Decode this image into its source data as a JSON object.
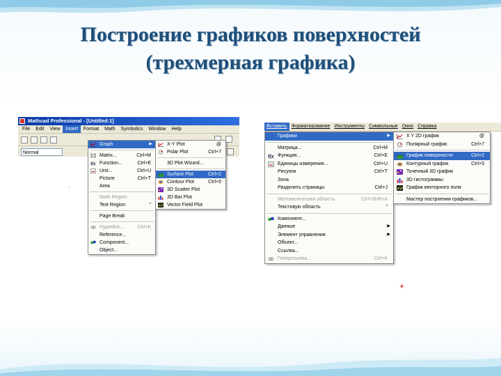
{
  "slide": {
    "title_line1": "Построение графиков поверхностей",
    "title_line2": "(трехмерная графика)"
  },
  "left": {
    "window_title": "Mathcad Professional - [Untitled:1]",
    "menubar": [
      "File",
      "Edit",
      "View",
      "Insert",
      "Format",
      "Math",
      "Symbolics",
      "Window",
      "Help"
    ],
    "style_value": "Normal",
    "insert_menu": [
      {
        "label": "Graph",
        "shortcut": "",
        "state": "sel",
        "submenu": true,
        "icon": "graph-icon"
      },
      {
        "sep": true
      },
      {
        "label": "Matrix...",
        "shortcut": "Ctrl+M",
        "icon": "matrix-icon"
      },
      {
        "label": "Function...",
        "shortcut": "Ctrl+E",
        "icon": "function-icon"
      },
      {
        "label": "Unit...",
        "shortcut": "Ctrl+U",
        "icon": "unit-icon"
      },
      {
        "label": "Picture",
        "shortcut": "Ctrl+T"
      },
      {
        "label": "Area"
      },
      {
        "sep": true
      },
      {
        "label": "Math Region",
        "state": "dis"
      },
      {
        "label": "Text Region",
        "shortcut": "\""
      },
      {
        "sep": true
      },
      {
        "label": "Page Break"
      },
      {
        "sep": true
      },
      {
        "label": "Hyperlink...",
        "shortcut": "Ctrl+K",
        "state": "dis",
        "icon": "hyperlink-icon"
      },
      {
        "label": "Reference..."
      },
      {
        "label": "Component...",
        "icon": "component-icon"
      },
      {
        "label": "Object..."
      }
    ],
    "graph_submenu": [
      {
        "label": "X-Y Plot",
        "shortcut": "@",
        "icon": "xy-plot-icon"
      },
      {
        "label": "Polar Plot",
        "shortcut": "Ctrl+7",
        "icon": "polar-plot-icon"
      },
      {
        "sep": true
      },
      {
        "label": "3D Plot Wizard..."
      },
      {
        "sep": true
      },
      {
        "label": "Surface Plot",
        "shortcut": "Ctrl+2",
        "state": "sel",
        "icon": "surface-plot-icon"
      },
      {
        "label": "Contour Plot",
        "shortcut": "Ctrl+5",
        "icon": "contour-plot-icon"
      },
      {
        "label": "3D Scatter Plot",
        "icon": "scatter-plot-icon"
      },
      {
        "label": "3D Bar Plot",
        "icon": "bar-plot-icon"
      },
      {
        "label": "Vector Field Plot",
        "icon": "vector-field-icon"
      }
    ]
  },
  "right": {
    "menubar": [
      "Вставить",
      "Форматирование",
      "Инструменты",
      "Символьные",
      "Окно",
      "Справка"
    ],
    "insert_menu": [
      {
        "label": "Графики",
        "state": "sel",
        "submenu": true
      },
      {
        "sep": true
      },
      {
        "label": "Матрица...",
        "shortcut": "Ctrl+M"
      },
      {
        "label": "Функция...",
        "shortcut": "Ctrl+E",
        "icon": "function-icon"
      },
      {
        "label": "Единицы измерения...",
        "shortcut": "Ctrl+U",
        "icon": "unit-icon"
      },
      {
        "label": "Рисунок",
        "shortcut": "Ctrl+T"
      },
      {
        "label": "Зона"
      },
      {
        "label": "Разделить страницы",
        "shortcut": "Ctrl+J"
      },
      {
        "sep": true
      },
      {
        "label": "Математическая область",
        "shortcut": "Ctrl+Shift+A",
        "state": "dis"
      },
      {
        "label": "Текстовую область",
        "shortcut": "\""
      },
      {
        "sep": true
      },
      {
        "label": "Компонент...",
        "icon": "component-icon"
      },
      {
        "label": "Данные",
        "submenu": true
      },
      {
        "label": "Элемент управления",
        "submenu": true
      },
      {
        "label": "Объект..."
      },
      {
        "label": "Ссылка..."
      },
      {
        "label": "Гиперссылка...",
        "shortcut": "Ctrl+K",
        "state": "dis",
        "icon": "hyperlink-icon"
      }
    ],
    "graph_submenu": [
      {
        "label": "X Y 2D график",
        "shortcut": "@",
        "icon": "xy-plot-icon"
      },
      {
        "label": "Полярный график",
        "shortcut": "Ctrl+7",
        "icon": "polar-plot-icon"
      },
      {
        "sep": true
      },
      {
        "label": "График поверхности",
        "shortcut": "Ctrl+2",
        "state": "sel",
        "icon": "surface-plot-icon"
      },
      {
        "label": "Контурный график",
        "shortcut": "Ctrl+5",
        "icon": "contour-plot-icon"
      },
      {
        "label": "Точечный 3D график",
        "icon": "scatter-plot-icon"
      },
      {
        "label": "3D гистограммы",
        "icon": "bar-plot-icon"
      },
      {
        "label": "График векторного поля",
        "icon": "vector-field-icon"
      },
      {
        "sep": true
      },
      {
        "label": "Мастер построения графиков..."
      }
    ]
  }
}
